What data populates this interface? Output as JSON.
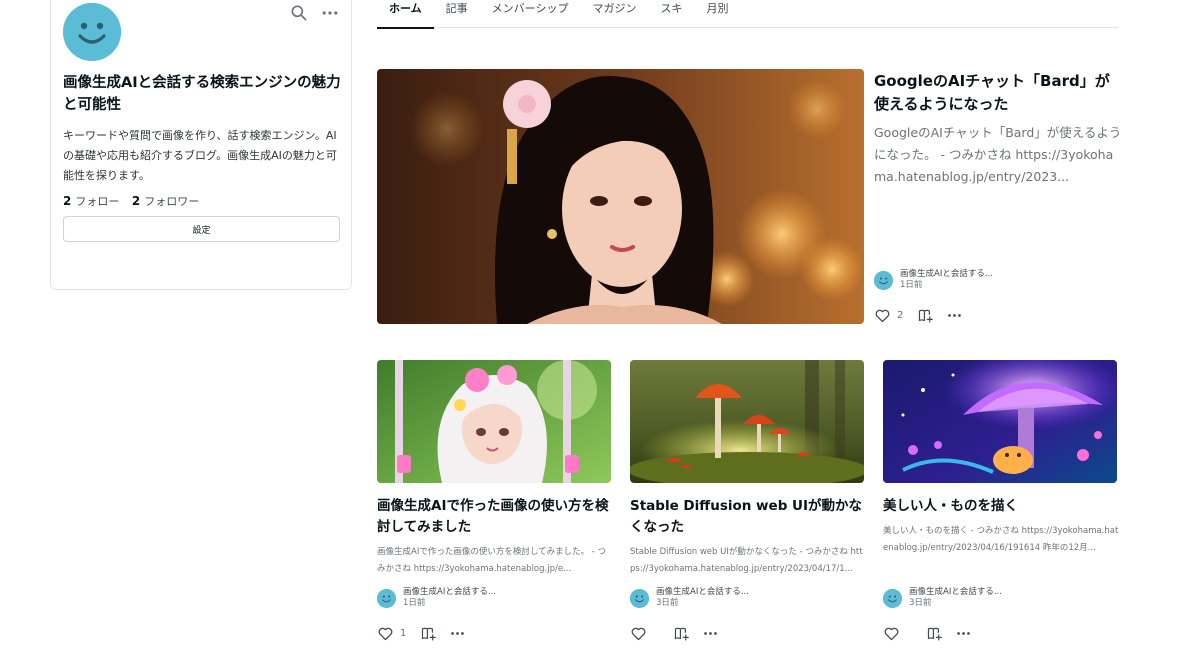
{
  "profile": {
    "name": "画像生成AIと会話する検索エンジンの魅力と可能性",
    "description": "キーワードや質問で画像を作り、話す検索エンジン。AIの基礎や応用も紹介するブログ。画像生成AIの魅力と可能性を探ります。",
    "follow_count": "2",
    "follow_label": "フォロー",
    "follower_count": "2",
    "follower_label": "フォロワー",
    "settings_label": "設定",
    "avatar_color": "#5bbcd6"
  },
  "tabs": [
    {
      "label": "ホーム",
      "active": true
    },
    {
      "label": "記事"
    },
    {
      "label": "メンバーシップ"
    },
    {
      "label": "マガジン"
    },
    {
      "label": "スキ"
    },
    {
      "label": "月別"
    }
  ],
  "featured": {
    "title": "GoogleのAIチャット「Bard」が使えるようになった",
    "excerpt": "GoogleのAIチャット「Bard」が使えるようになった。 - つみかさね https://3yokohama.hatenablog.jp/entry/2023...",
    "author": "画像生成AIと会話する...",
    "date": "1日前",
    "likes": "2"
  },
  "articles": [
    {
      "title": "画像生成AIで作った画像の使い方を検討してみました",
      "excerpt": "画像生成AIで作った画像の使い方を検討してみました。 - つみかさね https://3yokohama.hatenablog.jp/e...",
      "author": "画像生成AIと会話する...",
      "date": "1日前",
      "likes": "1"
    },
    {
      "title": "Stable Diffusion web UIが動かなくなった",
      "excerpt": "Stable Diffusion web UIが動かなくなった - つみかさね https://3yokohama.hatenablog.jp/entry/2023/04/17/1...",
      "author": "画像生成AIと会話する...",
      "date": "3日前",
      "likes": ""
    },
    {
      "title": "美しい人・ものを描く",
      "excerpt": "美しい人・ものを描く - つみかさね https://3yokohama.hatenablog.jp/entry/2023/04/16/191614 昨年の12月...",
      "author": "画像生成AIと会話する...",
      "date": "3日前",
      "likes": ""
    }
  ],
  "icons": {
    "search": "search-icon",
    "more": "more-dots-icon",
    "like": "heart-icon",
    "magazine": "magazine-add-icon"
  }
}
